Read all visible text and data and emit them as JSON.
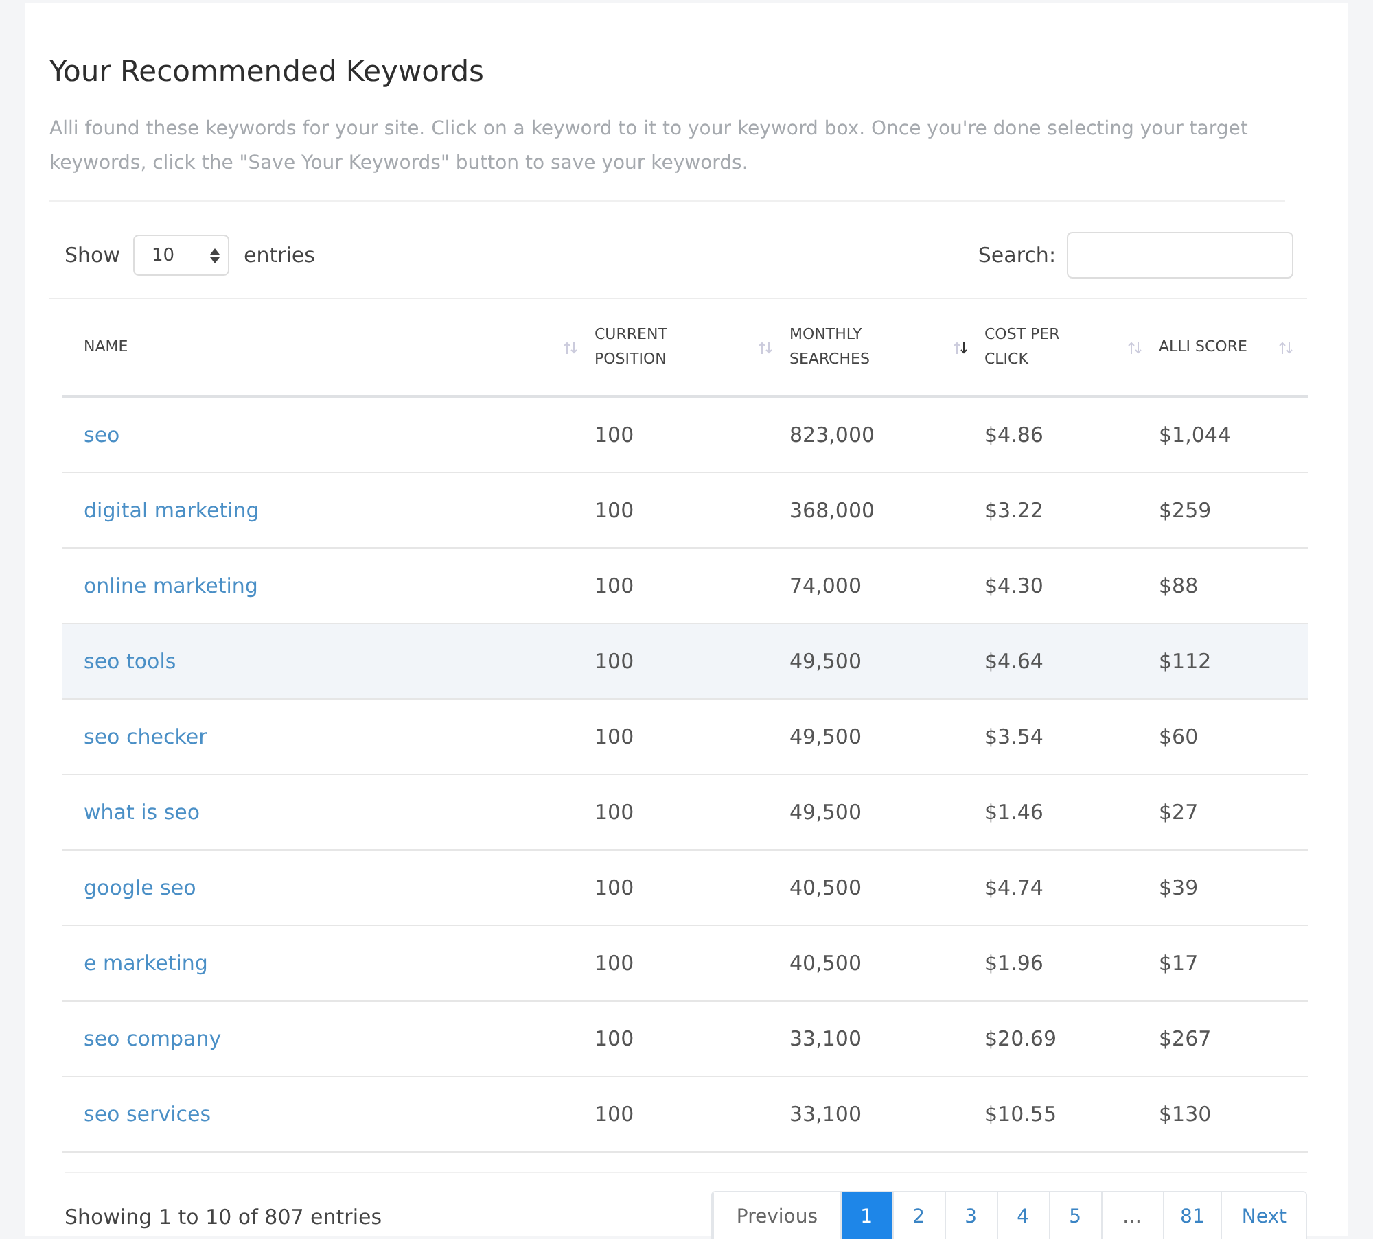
{
  "title": "Your Recommended Keywords",
  "description": "Alli found these keywords for your site. Click on a keyword to it to your keyword box. Once you're done selecting your target keywords, click the \"Save Your Keywords\" button to save your keywords.",
  "length_menu": {
    "before": "Show",
    "value": "10",
    "after": "entries"
  },
  "search": {
    "label": "Search:"
  },
  "table": {
    "columns": [
      {
        "label": "NAME",
        "sorted_desc": false
      },
      {
        "label": "CURRENT POSITION",
        "sorted_desc": false
      },
      {
        "label": "MONTHLY SEARCHES",
        "sorted_desc": true
      },
      {
        "label": "COST PER CLICK",
        "sorted_desc": false
      },
      {
        "label": "ALLI SCORE",
        "sorted_desc": false
      }
    ],
    "rows": [
      {
        "cells": [
          "seo",
          "100",
          "823,000",
          "$4.86",
          "$1,044"
        ],
        "hovered": false
      },
      {
        "cells": [
          "digital marketing",
          "100",
          "368,000",
          "$3.22",
          "$259"
        ],
        "hovered": false
      },
      {
        "cells": [
          "online marketing",
          "100",
          "74,000",
          "$4.30",
          "$88"
        ],
        "hovered": false
      },
      {
        "cells": [
          "seo tools",
          "100",
          "49,500",
          "$4.64",
          "$112"
        ],
        "hovered": true
      },
      {
        "cells": [
          "seo checker",
          "100",
          "49,500",
          "$3.54",
          "$60"
        ],
        "hovered": false
      },
      {
        "cells": [
          "what is seo",
          "100",
          "49,500",
          "$1.46",
          "$27"
        ],
        "hovered": false
      },
      {
        "cells": [
          "google seo",
          "100",
          "40,500",
          "$4.74",
          "$39"
        ],
        "hovered": false
      },
      {
        "cells": [
          "e marketing",
          "100",
          "40,500",
          "$1.96",
          "$17"
        ],
        "hovered": false
      },
      {
        "cells": [
          "seo company",
          "100",
          "33,100",
          "$20.69",
          "$267"
        ],
        "hovered": false
      },
      {
        "cells": [
          "seo services",
          "100",
          "33,100",
          "$10.55",
          "$130"
        ],
        "hovered": false
      }
    ]
  },
  "info": "Showing 1 to 10 of 807 entries",
  "pagination": [
    {
      "kind": "prev",
      "label": "Previous",
      "disabled": true,
      "selected": false
    },
    {
      "kind": "page",
      "label": "1",
      "disabled": false,
      "selected": true
    },
    {
      "kind": "page",
      "label": "2",
      "disabled": false,
      "selected": false
    },
    {
      "kind": "page",
      "label": "3",
      "disabled": false,
      "selected": false
    },
    {
      "kind": "page",
      "label": "4",
      "disabled": false,
      "selected": false
    },
    {
      "kind": "page",
      "label": "5",
      "disabled": false,
      "selected": false
    },
    {
      "kind": "ellipsis",
      "label": "…",
      "disabled": true,
      "selected": false
    },
    {
      "kind": "page",
      "label": "81",
      "disabled": false,
      "selected": false
    },
    {
      "kind": "next",
      "label": "Next",
      "disabled": false,
      "selected": false
    }
  ]
}
